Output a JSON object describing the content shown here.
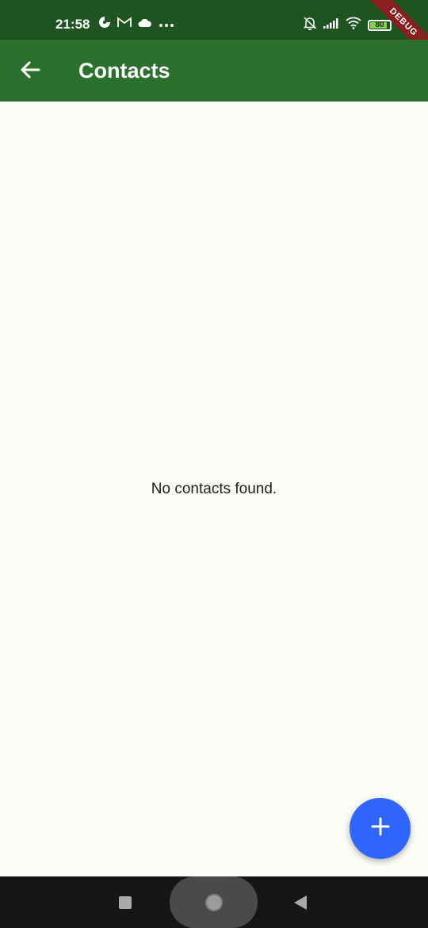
{
  "status_bar": {
    "time": "21:58",
    "battery_level": "80",
    "battery_fraction": 0.8,
    "left_icons": [
      "pie-icon",
      "gmail-icon",
      "cloud-icon",
      "more-dots-icon"
    ],
    "right_icons": [
      "bell-off-icon",
      "signal-icon",
      "wifi-icon",
      "battery-icon"
    ],
    "debug_label": "DEBUG"
  },
  "app_bar": {
    "title": "Contacts",
    "back_icon": "arrow-back-icon"
  },
  "main": {
    "empty_message": "No contacts found."
  },
  "fab": {
    "icon": "plus-icon"
  },
  "navigation": {
    "recents_icon": "square-icon",
    "home_icon": "circle-icon",
    "back_icon": "triangle-back-icon"
  },
  "colors": {
    "status_bar": "#1e541f",
    "app_bar": "#2c702d",
    "background": "#fbfcf7",
    "fab": "#2e66ff",
    "nav_bar": "#161616",
    "debug_ribbon": "#8a1f1f"
  }
}
